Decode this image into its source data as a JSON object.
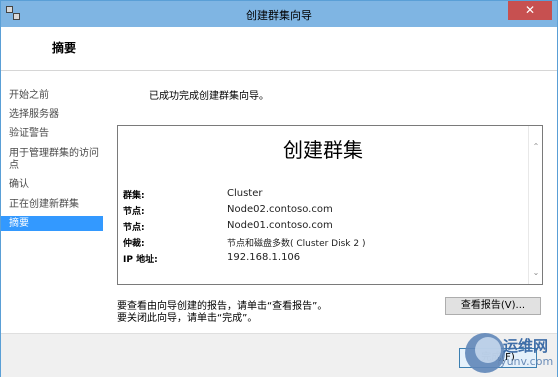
{
  "window": {
    "title": "创建群集向导",
    "close_label": "✕"
  },
  "header": {
    "title": "摘要"
  },
  "nav": {
    "items": [
      {
        "label": "开始之前"
      },
      {
        "label": "选择服务器"
      },
      {
        "label": "验证警告"
      },
      {
        "label": "用于管理群集的访问"
      },
      {
        "label": "点"
      },
      {
        "label": "确认"
      },
      {
        "label": "正在创建新群集"
      },
      {
        "label": "摘要"
      }
    ]
  },
  "content": {
    "success_message": "已成功完成创建群集向导。",
    "report": {
      "title": "创建群集",
      "rows": [
        {
          "label": "群集:",
          "value": "Cluster"
        },
        {
          "label": "节点:",
          "value": "Node02.contoso.com"
        },
        {
          "label": "节点:",
          "value": "Node01.contoso.com"
        },
        {
          "label": "仲裁:",
          "value": "节点和磁盘多数( Cluster Disk 2 )"
        },
        {
          "label": "IP 地址:",
          "value": "192.168.1.106"
        }
      ],
      "scroll_up": "⌃",
      "scroll_down": "⌄"
    },
    "hint_view": "要查看由向导创建的报告，请单击“查看报告”。",
    "hint_close": "要关闭此向导，请单击“完成”。",
    "view_report_button": "查看报告(V)..."
  },
  "footer": {
    "finish_button": "完成(F)"
  },
  "watermark": {
    "cn": "运维网",
    "en": "iyunv.com"
  },
  "colors": {
    "titlebar": "#7fb5e3",
    "close": "#c75050",
    "nav_active": "#3399ff"
  }
}
